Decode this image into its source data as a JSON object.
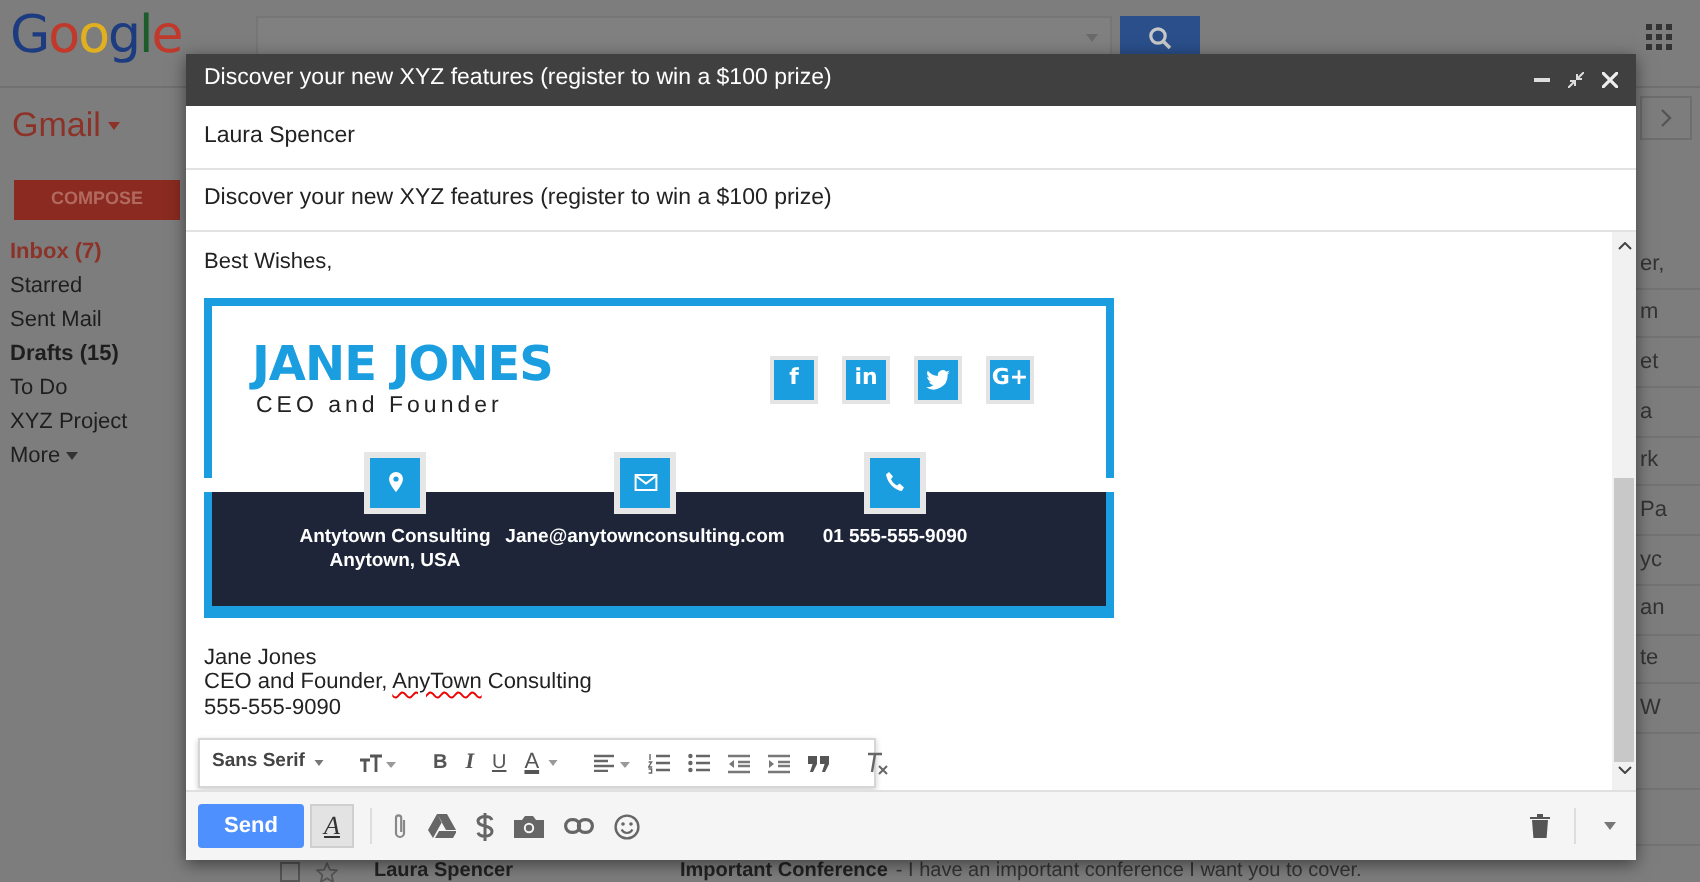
{
  "header": {
    "logo": [
      {
        "text": "G",
        "color": "#1d3c80"
      },
      {
        "text": "o",
        "color": "#c0392b"
      },
      {
        "text": "o",
        "color": "#e0b020"
      },
      {
        "text": "g",
        "color": "#1d3c80"
      },
      {
        "text": "l",
        "color": "#1b5c2a"
      },
      {
        "text": "e",
        "color": "#c0392b"
      }
    ]
  },
  "sidebar": {
    "app_label": "Gmail",
    "compose": "COMPOSE",
    "items": [
      {
        "label": "Inbox (7)",
        "selected": true,
        "bold": true
      },
      {
        "label": "Starred",
        "selected": false,
        "bold": false
      },
      {
        "label": "Sent Mail",
        "selected": false,
        "bold": false
      },
      {
        "label": "Drafts (15)",
        "selected": false,
        "bold": true
      },
      {
        "label": "To Do",
        "selected": false,
        "bold": false
      },
      {
        "label": "XYZ Project",
        "selected": false,
        "bold": false
      },
      {
        "label": "More",
        "selected": false,
        "bold": false
      }
    ]
  },
  "message_list": {
    "snippets": [
      "er,",
      "m",
      "et",
      "a",
      "rk",
      "Pa",
      "yc",
      "an",
      "te",
      "W"
    ],
    "last_row": {
      "checked": false,
      "sender": "Laura Spencer",
      "subject": "Important Conference",
      "preview": "- I have an important conference I want you to cover."
    }
  },
  "compose": {
    "title": "Discover your new XYZ features (register to win a $100 prize)",
    "to": "Laura Spencer",
    "subject": "Discover your new XYZ features (register to win a $100 prize)",
    "greeting": "Best Wishes,",
    "signature_card": {
      "name": "JANE JONES",
      "role": "CEO and Founder",
      "socials": [
        {
          "kind": "glyph",
          "label": "f"
        },
        {
          "kind": "glyph",
          "label": "in"
        },
        {
          "kind": "bird"
        },
        {
          "kind": "glyph",
          "label": "G+"
        }
      ],
      "contacts": [
        {
          "kind": "location",
          "lines": [
            "Antytown Consulting",
            "Anytown, USA"
          ]
        },
        {
          "kind": "email",
          "lines": [
            "Jane@anytownconsulting.com"
          ]
        },
        {
          "kind": "phone",
          "lines": [
            "01 555-555-9090"
          ]
        }
      ]
    },
    "signature_lines": [
      [
        {
          "text": "Jane Jones",
          "misspelled": false
        }
      ],
      [
        {
          "text": "CEO and Founder, ",
          "misspelled": false
        },
        {
          "text": "AnyTown",
          "misspelled": true
        },
        {
          "text": " Consulting",
          "misspelled": false
        }
      ],
      [
        {
          "text": "555-555-9090",
          "misspelled": false
        }
      ]
    ],
    "format_toolbar": {
      "font": "Sans Serif",
      "buttons": [
        {
          "kind": "size"
        },
        {
          "kind": "bold",
          "label": "B"
        },
        {
          "kind": "italic",
          "label": "I"
        },
        {
          "kind": "underline",
          "label": "U"
        },
        {
          "kind": "color",
          "label": "A"
        },
        {
          "kind": "align"
        },
        {
          "kind": "numbered"
        },
        {
          "kind": "bulleted"
        },
        {
          "kind": "outdent"
        },
        {
          "kind": "indent"
        },
        {
          "kind": "quote"
        },
        {
          "kind": "clear"
        }
      ]
    },
    "send": "Send",
    "format_toggle": {
      "label": "A",
      "selected": true
    },
    "actions": [
      {
        "kind": "attach"
      },
      {
        "kind": "drive"
      },
      {
        "kind": "money"
      },
      {
        "kind": "camera"
      },
      {
        "kind": "link"
      },
      {
        "kind": "emoji"
      }
    ]
  }
}
